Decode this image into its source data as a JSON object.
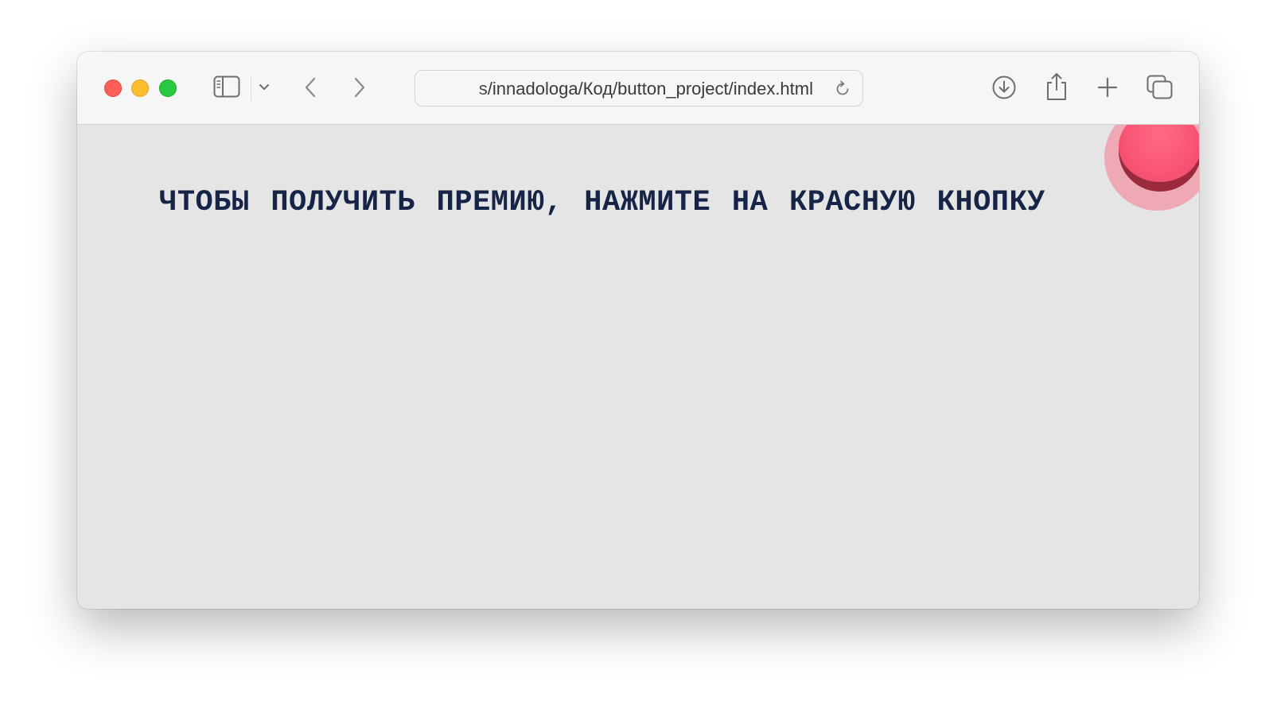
{
  "browser": {
    "url": "s/innadologa/Код/button_project/index.html",
    "icons": {
      "sidebar": "sidebar-icon",
      "sidebar_menu": "chevron-down-icon",
      "back": "chevron-left-icon",
      "forward": "chevron-right-icon",
      "reload": "reload-icon",
      "download": "download-icon",
      "share": "share-icon",
      "new_tab": "plus-icon",
      "tab_overview": "tabs-icon"
    },
    "colors": {
      "close": "#ff5f57",
      "minimize": "#febc2e",
      "zoom": "#28c840"
    }
  },
  "page": {
    "headline": "Чтобы получить премию, нажмите на красную кнопку",
    "background": "#e5e5e6",
    "text_color": "#162447",
    "button_color": "#fa5676"
  }
}
